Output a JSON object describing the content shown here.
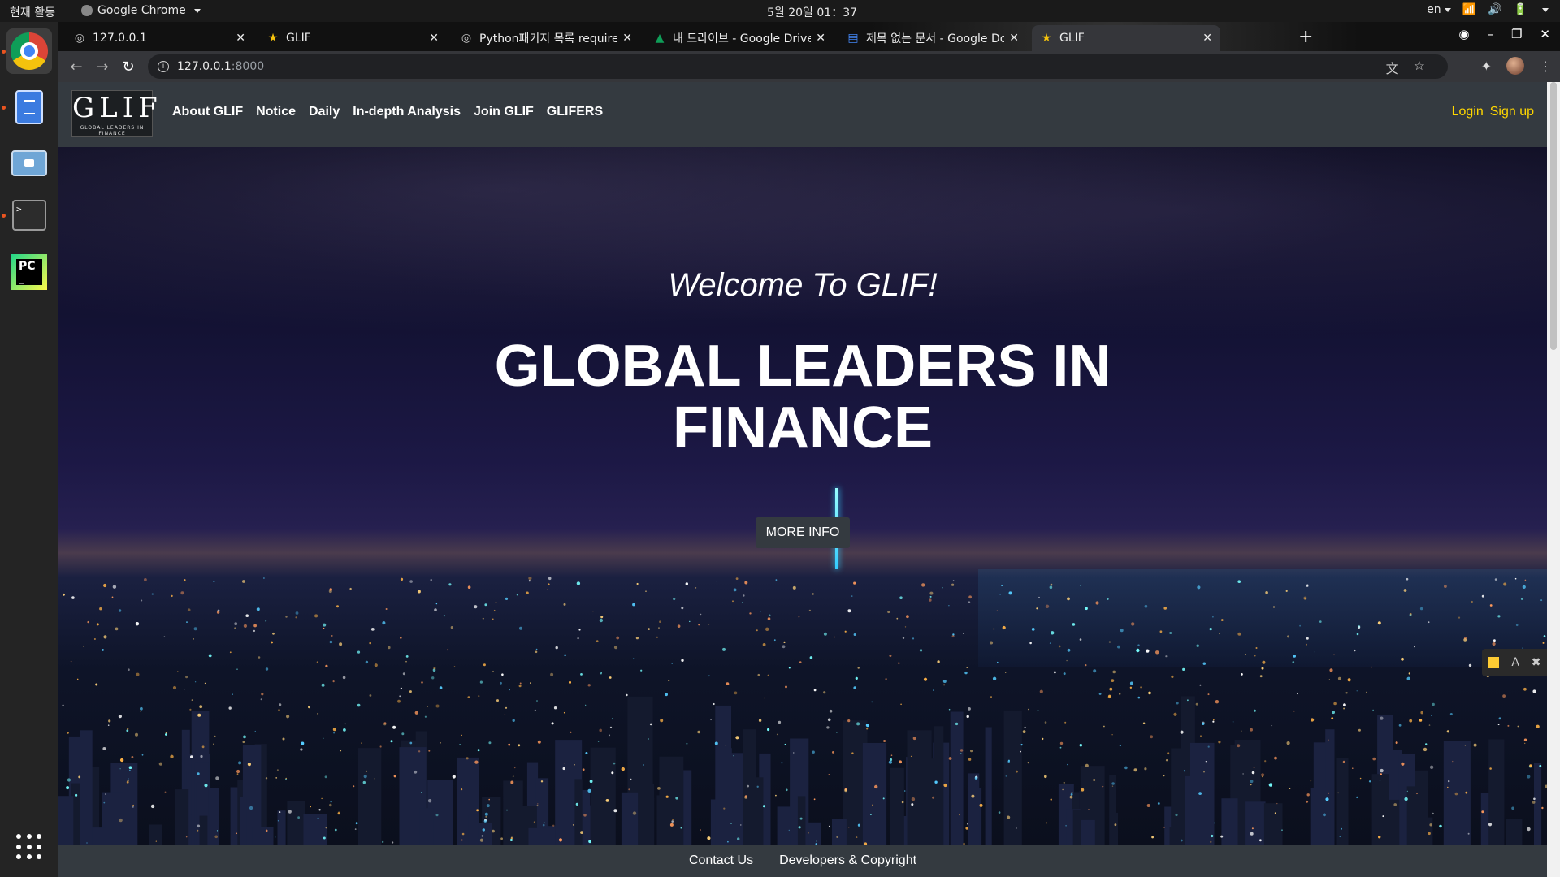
{
  "topbar": {
    "activities": "현재 활동",
    "app_menu": "Google Chrome",
    "clock": "5월 20일  01：37",
    "lang": "en"
  },
  "tabs": [
    {
      "title": "127.0.0.1",
      "icon": "globe-icon"
    },
    {
      "title": "GLIF",
      "icon": "star-icon"
    },
    {
      "title": "Python패키지 목록 require",
      "icon": "globe-icon"
    },
    {
      "title": "내 드라이브 - Google Drive",
      "icon": "drive-icon"
    },
    {
      "title": "제목 없는 문서 - Google Do",
      "icon": "docs-icon"
    },
    {
      "title": "GLIF",
      "icon": "star-icon"
    }
  ],
  "address": {
    "host": "127.0.0.1",
    "port": ":8000"
  },
  "site": {
    "logo_text": "GLIF",
    "logo_subtext": "GLOBAL LEADERS IN FINANCE",
    "nav": [
      "About GLIF",
      "Notice",
      "Daily",
      "In-depth Analysis",
      "Join GLIF",
      "GLIFERS"
    ],
    "login": "Login",
    "signup": "Sign up",
    "welcome": "Welcome To GLIF!",
    "headline_line1": "GLOBAL LEADERS IN",
    "headline_line2": "FINANCE",
    "cta": "MORE INFO",
    "footer": [
      "Contact Us",
      "Developers & Copyright"
    ]
  },
  "colors": {
    "nav_bg": "#343a40",
    "auth_link": "#ffd700"
  }
}
